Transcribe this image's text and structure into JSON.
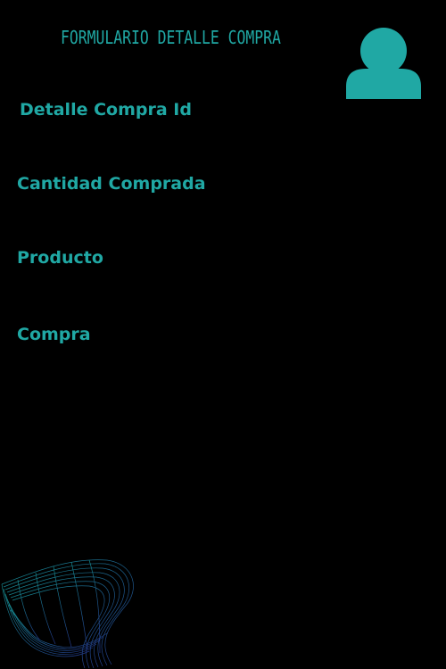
{
  "header": {
    "title": "Formulario Detalle Compra",
    "avatar_icon": "user-icon"
  },
  "form": {
    "fields": [
      {
        "label": "Detalle Compra Id"
      },
      {
        "label": "Cantidad Comprada"
      },
      {
        "label": "Producto"
      },
      {
        "label": "Compra"
      }
    ]
  },
  "decoration": {
    "icon": "wave-mesh-graphic"
  },
  "colors": {
    "background": "#000000",
    "accent": "#20a8a4"
  }
}
